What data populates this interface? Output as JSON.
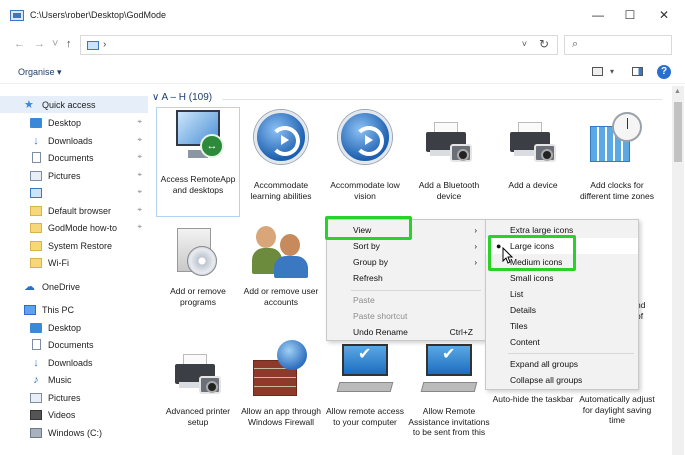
{
  "window": {
    "title": "C:\\Users\\rober\\Desktop\\GodMode",
    "minimize": "—",
    "maximize": "☐",
    "close": "✕"
  },
  "nav": {
    "back": "←",
    "forward": "→",
    "recent": "˅",
    "up": "↑",
    "breadcrumb": "›",
    "dropdown": "˅",
    "refresh": "↻",
    "search_icon": "⌕"
  },
  "toolbar": {
    "organise": "Organise ▾",
    "view_dropdown": "▾",
    "help": "?"
  },
  "sidebar": {
    "items": [
      {
        "label": "Quick access",
        "icon": "star-icon",
        "pinned": false
      },
      {
        "label": "Desktop",
        "icon": "desktop-icon",
        "pinned": true
      },
      {
        "label": "Downloads",
        "icon": "download-icon",
        "pinned": true
      },
      {
        "label": "Documents",
        "icon": "documents-icon",
        "pinned": true
      },
      {
        "label": "Pictures",
        "icon": "pictures-icon",
        "pinned": true
      },
      {
        "label": "",
        "icon": "pc-icon",
        "pinned": true
      },
      {
        "label": "Default browser",
        "icon": "folder-icon",
        "pinned": true
      },
      {
        "label": "GodMode how-to",
        "icon": "folder-icon",
        "pinned": true
      },
      {
        "label": "System Restore",
        "icon": "folder-icon",
        "pinned": false
      },
      {
        "label": "Wi-Fi",
        "icon": "folder-icon",
        "pinned": false
      },
      {
        "label": "OneDrive",
        "icon": "cloud-icon",
        "pinned": false
      },
      {
        "label": "This PC",
        "icon": "this-pc-icon",
        "pinned": false
      },
      {
        "label": "Desktop",
        "icon": "desktop-icon",
        "pinned": false
      },
      {
        "label": "Documents",
        "icon": "documents-icon",
        "pinned": false
      },
      {
        "label": "Downloads",
        "icon": "download-icon",
        "pinned": false
      },
      {
        "label": "Music",
        "icon": "music-icon",
        "pinned": false
      },
      {
        "label": "Pictures",
        "icon": "pictures-icon",
        "pinned": false
      },
      {
        "label": "Videos",
        "icon": "videos-icon",
        "pinned": false
      },
      {
        "label": "Windows (C:)",
        "icon": "drive-icon",
        "pinned": false
      }
    ],
    "pin_glyph": "📌"
  },
  "content": {
    "group_header": "∨ A – H (109)",
    "tiles": [
      {
        "label": "Access RemoteApp and desktops"
      },
      {
        "label": "Accommodate learning abilities"
      },
      {
        "label": "Accommodate low vision"
      },
      {
        "label": "Add a Bluetooth device"
      },
      {
        "label": "Add a device"
      },
      {
        "label": "Add clocks for different time zones"
      },
      {
        "label": "Add or remove programs"
      },
      {
        "label": "Add or remove user accounts"
      },
      {
        "label": "nd"
      },
      {
        "label": "of"
      },
      {
        "label": "Advanced printer setup"
      },
      {
        "label": "Allow an app through Windows Firewall"
      },
      {
        "label": "Allow remote access to your computer"
      },
      {
        "label": "Allow Remote Assistance invitations to be sent from this"
      },
      {
        "label": "Auto-hide the taskbar"
      },
      {
        "label": "Automatically adjust for daylight saving time"
      }
    ]
  },
  "context_menu": {
    "items": [
      {
        "label": "View",
        "submenu": true,
        "enabled": true
      },
      {
        "label": "Sort by",
        "submenu": true,
        "enabled": true
      },
      {
        "label": "Group by",
        "submenu": true,
        "enabled": true
      },
      {
        "label": "Refresh",
        "submenu": false,
        "enabled": true
      },
      {
        "label": "Paste",
        "submenu": false,
        "enabled": false
      },
      {
        "label": "Paste shortcut",
        "submenu": false,
        "enabled": false
      },
      {
        "label": "Undo Rename",
        "submenu": false,
        "enabled": true,
        "shortcut": "Ctrl+Z"
      }
    ],
    "arrow": "›"
  },
  "view_submenu": {
    "items": [
      {
        "label": "Extra large icons"
      },
      {
        "label": "Large icons",
        "selected": true
      },
      {
        "label": "Medium icons"
      },
      {
        "label": "Small icons"
      },
      {
        "label": "List"
      },
      {
        "label": "Details"
      },
      {
        "label": "Tiles"
      },
      {
        "label": "Content"
      },
      {
        "label": "Expand all groups"
      },
      {
        "label": "Collapse all groups"
      }
    ],
    "bullet": "●"
  },
  "colors": {
    "highlight": "#29d12b",
    "accent": "#2a6fcf"
  }
}
